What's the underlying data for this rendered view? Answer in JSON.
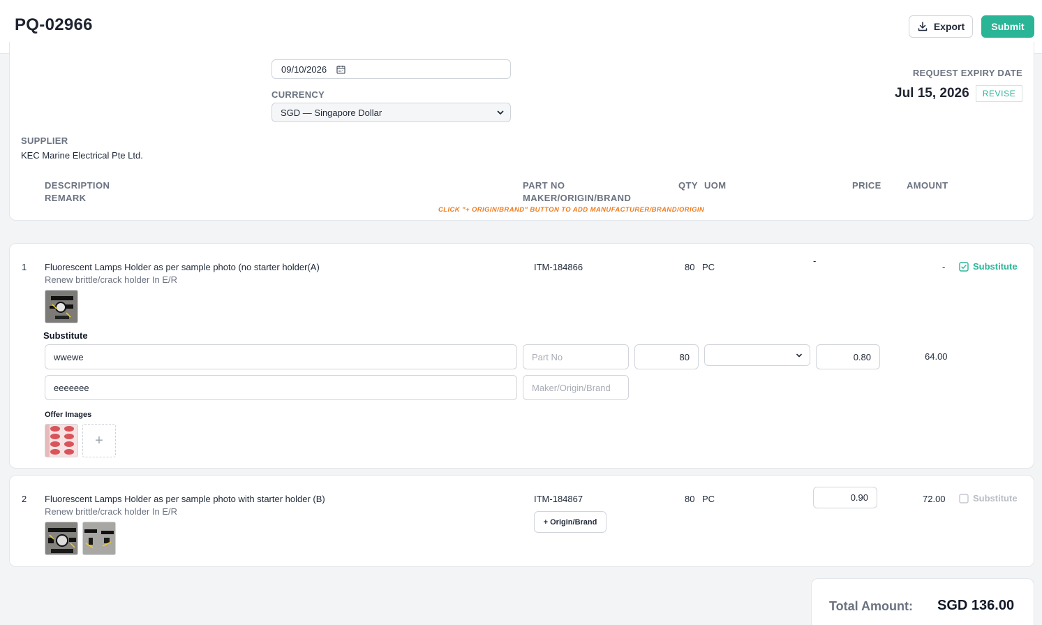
{
  "header": {
    "title": "PQ-02966",
    "export_label": "Export",
    "submit_label": "Submit"
  },
  "form": {
    "date_value": "09/10/2026",
    "currency_label": "CURRENCY",
    "currency_value": "SGD — Singapore Dollar",
    "supplier_label": "SUPPLIER",
    "supplier_value": "KEC Marine Electrical Pte Ltd.",
    "expiry_label": "REQUEST EXPIRY DATE",
    "expiry_value": "Jul 15, 2026",
    "revise_label": "REVISE"
  },
  "table_headers": {
    "description": "DESCRIPTION",
    "remark": "REMARK",
    "part_no": "PART NO",
    "maker": "MAKER/ORIGIN/BRAND",
    "qty": "QTY",
    "uom": "UOM",
    "price": "PRICE",
    "amount": "AMOUNT",
    "hint": "CLICK \"+ ORIGIN/BRAND\" BUTTON TO ADD MANUFACTURER/BRAND/ORIGIN"
  },
  "items": [
    {
      "index": "1",
      "description": "Fluorescent Lamps Holder as per sample photo (no starter holder(A)",
      "remark": "Renew brittle/crack holder In E/R",
      "part_no": "ITM-184866",
      "qty": "80",
      "uom": "PC",
      "price": "-",
      "amount": "-",
      "substitute_label": "Substitute",
      "substitute_checked": true,
      "substitute_section": {
        "heading": "Substitute",
        "description_value": "wwewe",
        "remark_value": "eeeeeee",
        "part_no_placeholder": "Part No",
        "maker_placeholder": "Maker/Origin/Brand",
        "qty_value": "80",
        "uom_value": "",
        "price_value": "0.80",
        "amount": "64.00",
        "offer_images_label": "Offer Images",
        "add_image_label": "+"
      }
    },
    {
      "index": "2",
      "description": "Fluorescent Lamps Holder as per sample photo with starter holder (B)",
      "remark": "Renew brittle/crack holder In E/R",
      "part_no": "ITM-184867",
      "origin_button_label": "+ Origin/Brand",
      "qty": "80",
      "uom": "PC",
      "price_value": "0.90",
      "amount": "72.00",
      "substitute_label": "Substitute",
      "substitute_checked": false
    }
  ],
  "total": {
    "label": "Total Amount:",
    "value": "SGD 136.00"
  },
  "colors": {
    "accent": "#2bb597",
    "hint": "#f07b1d",
    "muted": "#6b7280"
  }
}
